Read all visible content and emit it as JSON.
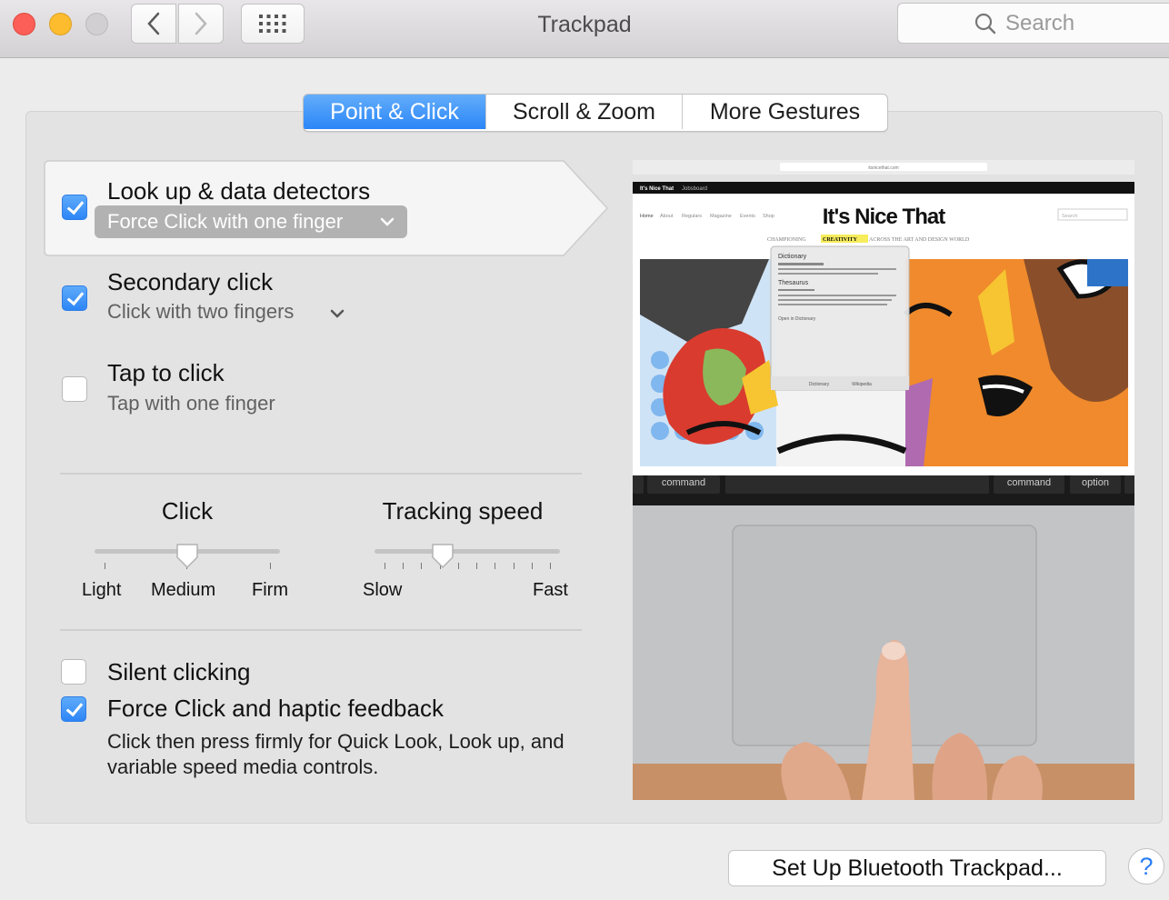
{
  "window": {
    "title": "Trackpad"
  },
  "search": {
    "placeholder": "Search"
  },
  "tabs": [
    {
      "label": "Point & Click",
      "active": true
    },
    {
      "label": "Scroll & Zoom",
      "active": false
    },
    {
      "label": "More Gestures",
      "active": false
    }
  ],
  "options": {
    "lookup": {
      "title": "Look up & data detectors",
      "value": "Force Click with one finger",
      "checked": true
    },
    "secondary": {
      "title": "Secondary click",
      "value": "Click with two fingers",
      "checked": true
    },
    "tap": {
      "title": "Tap to click",
      "subtitle": "Tap with one finger",
      "checked": false
    }
  },
  "sliders": {
    "click": {
      "title": "Click",
      "labels": [
        "Light",
        "Medium",
        "Firm"
      ],
      "value": "Medium"
    },
    "tracking": {
      "title": "Tracking speed",
      "min_label": "Slow",
      "max_label": "Fast",
      "level": 0.35
    }
  },
  "bottom_options": {
    "silent": {
      "title": "Silent clicking",
      "checked": false
    },
    "force": {
      "title": "Force Click and haptic feedback",
      "checked": true,
      "description": "Click then press firmly for Quick Look, Look up, and variable speed media controls."
    }
  },
  "preview": {
    "site_logo": "It's Nice That",
    "tagline_pre": "CHAMPIONING",
    "tagline_word": "CREATIVITY",
    "tagline_post": "ACROSS THE ART AND DESIGN WORLD",
    "site_search": "Search",
    "nav": [
      "Home",
      "About",
      "Regulars",
      "Magazine",
      "Events",
      "Shop"
    ],
    "top_strip": [
      "It's Nice That",
      "Jobsboard"
    ],
    "address": "itsnicethat.com",
    "popover": {
      "heading1": "Dictionary",
      "heading2": "Thesaurus",
      "open_link": "Open in Dictionary",
      "buttons": [
        "Dictionary",
        "Wikipedia"
      ]
    },
    "keys": {
      "left": "command",
      "right_cmd": "command",
      "right_opt": "option"
    }
  },
  "footer": {
    "bluetooth_button": "Set Up Bluetooth Trackpad...",
    "help": "?"
  }
}
